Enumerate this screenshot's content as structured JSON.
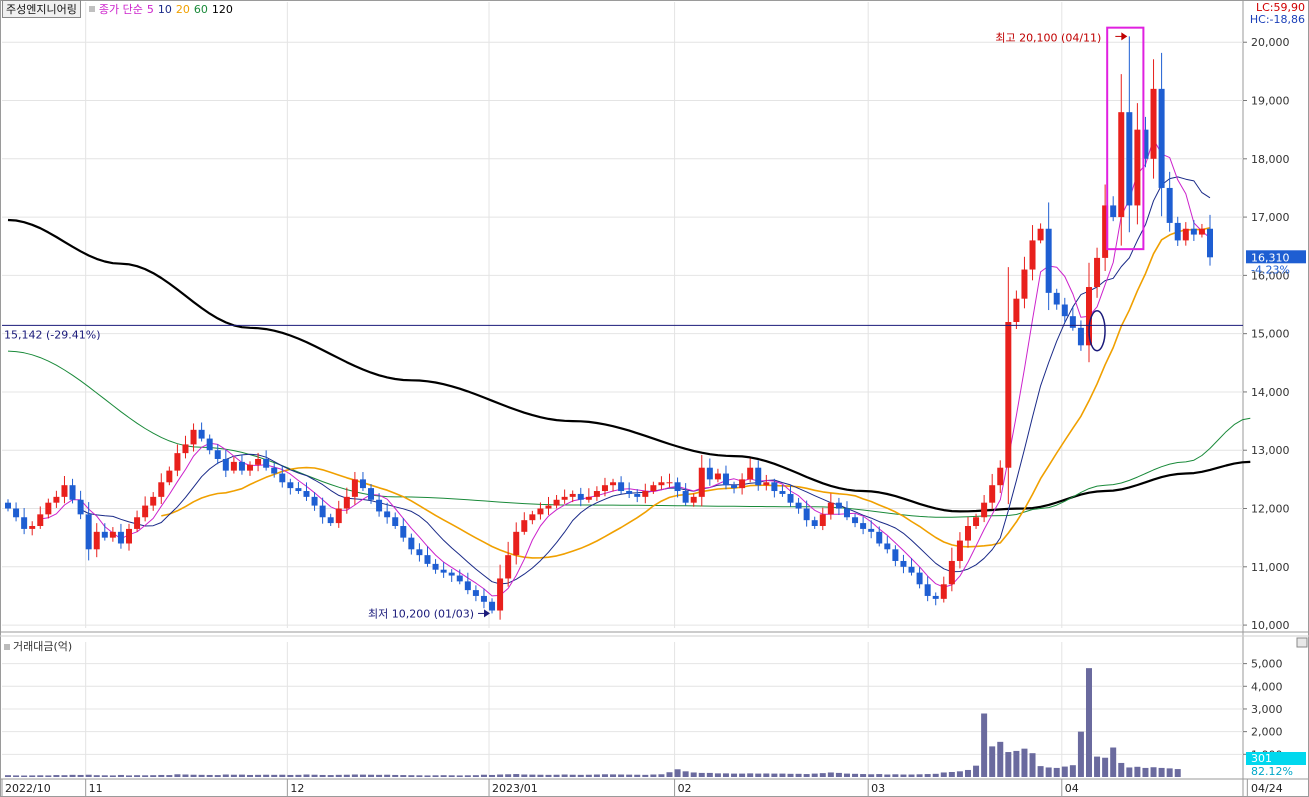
{
  "header": {
    "stock_name": "주성엔지니어링",
    "ma_label": "종가 단순",
    "ma_periods": [
      {
        "label": "5",
        "color": "#cc22cc"
      },
      {
        "label": "10",
        "color": "#1a2a88"
      },
      {
        "label": "20",
        "color": "#f0a000"
      },
      {
        "label": "60",
        "color": "#1a8a3a"
      },
      {
        "label": "120",
        "color": "#000000"
      }
    ],
    "lc": "LC:59,90",
    "hc": "HC:-18,86"
  },
  "volume_panel": {
    "label": "거래대금(억)"
  },
  "annotations": {
    "high": "최고 20,100 (04/11)",
    "low": "최저 10,200 (01/03)",
    "hline": "15,142 (-29.41%)",
    "current_price": "16,310",
    "current_change": "-4.23%",
    "current_volume": "301",
    "volume_pct": "82.12%"
  },
  "chart_data": {
    "type": "candlestick",
    "price_ticks": [
      "20,000",
      "19,000",
      "18,000",
      "17,000",
      "16,000",
      "15,000",
      "14,000",
      "13,000",
      "12,000",
      "11,000",
      "10,000"
    ],
    "price_ylim": [
      9950,
      20450
    ],
    "volume_ticks": [
      "5,000",
      "4,000",
      "3,000",
      "2,000",
      "1,000"
    ],
    "volume_ylim": [
      0,
      5600
    ],
    "x_labels": [
      {
        "label": "2022/10",
        "index": 0
      },
      {
        "label": "11",
        "index": 10
      },
      {
        "label": "12",
        "index": 35
      },
      {
        "label": "2023/01",
        "index": 60
      },
      {
        "label": "02",
        "index": 83
      },
      {
        "label": "03",
        "index": 107
      },
      {
        "label": "04",
        "index": 131
      },
      {
        "label": "04/24",
        "index": 154
      }
    ],
    "hline_value": 15142,
    "high_index": 139,
    "low_index": 60,
    "closes": [
      12000,
      11850,
      11650,
      11700,
      11900,
      12100,
      12200,
      12400,
      12150,
      11900,
      11300,
      11600,
      11500,
      11600,
      11400,
      11650,
      11850,
      12050,
      12200,
      12450,
      12650,
      12950,
      13100,
      13350,
      13200,
      13000,
      12850,
      12650,
      12800,
      12650,
      12750,
      12850,
      12700,
      12600,
      12450,
      12350,
      12300,
      12200,
      12050,
      11850,
      11750,
      12000,
      12200,
      12500,
      12350,
      12150,
      11950,
      11850,
      11700,
      11500,
      11300,
      11200,
      11050,
      10950,
      10900,
      10850,
      10750,
      10600,
      10500,
      10400,
      10250,
      10800,
      11200,
      11600,
      11800,
      11900,
      12000,
      12050,
      12150,
      12200,
      12250,
      12150,
      12200,
      12300,
      12400,
      12450,
      12300,
      12250,
      12200,
      12300,
      12400,
      12450,
      12450,
      12300,
      12100,
      12200,
      12700,
      12500,
      12600,
      12400,
      12350,
      12500,
      12700,
      12400,
      12450,
      12300,
      12250,
      12100,
      12000,
      11800,
      11700,
      11900,
      12100,
      12000,
      11850,
      11750,
      11650,
      11600,
      11400,
      11300,
      11100,
      11000,
      10900,
      10700,
      10500,
      10450,
      10700,
      11100,
      11450,
      11700,
      11850,
      12100,
      12400,
      12700,
      15200,
      15600,
      16100,
      16600,
      16800,
      15700,
      15500,
      15300,
      15100,
      14800,
      15800,
      16300,
      17200,
      17000,
      18800,
      17200,
      18500,
      18000,
      19200,
      17500,
      16900,
      16600,
      16800,
      16700,
      16800,
      16310
    ],
    "ma5_first_index": 4,
    "ma10_first_index": 9,
    "ma20_first_index": 19,
    "ma60_anchors": [
      [
        0,
        14700
      ],
      [
        24,
        13050
      ],
      [
        48,
        12200
      ],
      [
        70,
        12060
      ],
      [
        100,
        12030
      ],
      [
        116,
        11850
      ],
      [
        124,
        11880
      ],
      [
        128,
        12000
      ],
      [
        136,
        12400
      ],
      [
        146,
        12800
      ],
      [
        154,
        13550
      ]
    ],
    "ma120_anchors": [
      [
        0,
        16950
      ],
      [
        14,
        16200
      ],
      [
        30,
        15100
      ],
      [
        50,
        14200
      ],
      [
        70,
        13500
      ],
      [
        90,
        12900
      ],
      [
        106,
        12300
      ],
      [
        118,
        11950
      ],
      [
        126,
        12000
      ],
      [
        136,
        12300
      ],
      [
        146,
        12600
      ],
      [
        154,
        12800
      ]
    ],
    "volumes": [
      80,
      70,
      65,
      70,
      75,
      70,
      85,
      80,
      95,
      90,
      100,
      80,
      75,
      70,
      90,
      70,
      80,
      75,
      80,
      90,
      85,
      120,
      110,
      100,
      95,
      90,
      85,
      110,
      100,
      105,
      90,
      95,
      100,
      95,
      100,
      90,
      95,
      110,
      100,
      90,
      85,
      95,
      100,
      110,
      105,
      100,
      95,
      100,
      90,
      85,
      80,
      75,
      70,
      75,
      80,
      75,
      70,
      75,
      80,
      100,
      90,
      110,
      120,
      130,
      110,
      105,
      100,
      95,
      100,
      110,
      100,
      95,
      100,
      110,
      120,
      115,
      110,
      105,
      100,
      95,
      110,
      120,
      210,
      340,
      250,
      200,
      180,
      180,
      160,
      160,
      150,
      150,
      160,
      150,
      155,
      150,
      150,
      140,
      140,
      130,
      150,
      170,
      200,
      180,
      150,
      140,
      130,
      120,
      130,
      110,
      120,
      110,
      110,
      120,
      130,
      140,
      200,
      220,
      250,
      310,
      500,
      2800,
      1350,
      1550,
      1100,
      1150,
      1250,
      1050,
      480,
      420,
      400,
      460,
      520,
      2000,
      4800,
      900,
      850,
      1300,
      620,
      420,
      450,
      400,
      430,
      400,
      380,
      350
    ]
  }
}
